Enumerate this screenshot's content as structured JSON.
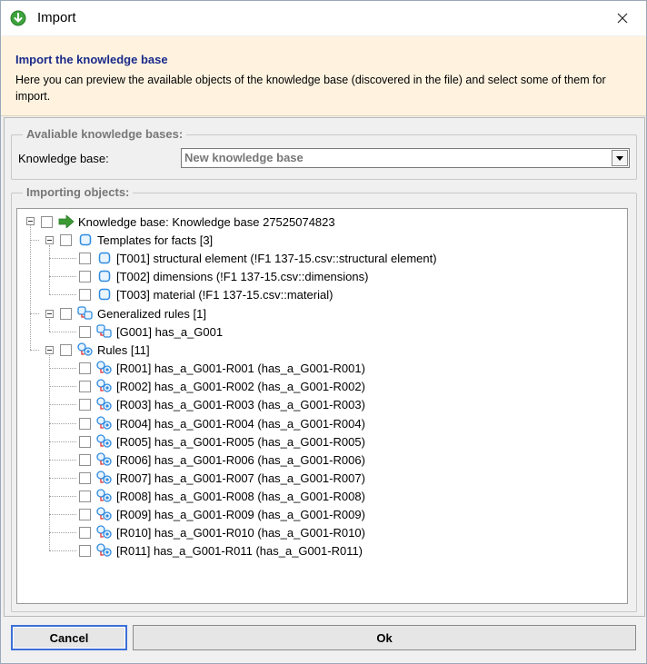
{
  "window": {
    "title": "Import",
    "icon": "import-icon",
    "close_icon": "close-icon"
  },
  "header": {
    "title": "Import the knowledge base",
    "description": "Here you can preview the available objects of the knowledge base (discovered in the file) and select some of them for import."
  },
  "kb_group": {
    "label": "Avaliable knowledge bases:",
    "field_label": "Knowledge base:",
    "selected": "New knowledge base"
  },
  "objects_group": {
    "label": "Importing objects:"
  },
  "tree": {
    "root": "Knowledge base: Knowledge base 27525074823",
    "templates": {
      "label": "Templates for facts [3]",
      "items": [
        "[T001] structural element (!F1 137-15.csv::structural element)",
        "[T002] dimensions (!F1 137-15.csv::dimensions)",
        "[T003] material (!F1 137-15.csv::material)"
      ]
    },
    "generalized": {
      "label": "Generalized rules [1]",
      "items": [
        "[G001] has_a_G001"
      ]
    },
    "rules": {
      "label": "Rules [11]",
      "items": [
        "[R001] has_a_G001-R001 (has_a_G001-R001)",
        "[R002] has_a_G001-R002 (has_a_G001-R002)",
        "[R003] has_a_G001-R003 (has_a_G001-R003)",
        "[R004] has_a_G001-R004 (has_a_G001-R004)",
        "[R005] has_a_G001-R005 (has_a_G001-R005)",
        "[R006] has_a_G001-R006 (has_a_G001-R006)",
        "[R007] has_a_G001-R007 (has_a_G001-R007)",
        "[R008] has_a_G001-R008 (has_a_G001-R008)",
        "[R009] has_a_G001-R009 (has_a_G001-R009)",
        "[R010] has_a_G001-R010 (has_a_G001-R010)",
        "[R011] has_a_G001-R011 (has_a_G001-R011)"
      ]
    }
  },
  "footer": {
    "cancel_label": "Cancel",
    "ok_label": "Ok"
  }
}
